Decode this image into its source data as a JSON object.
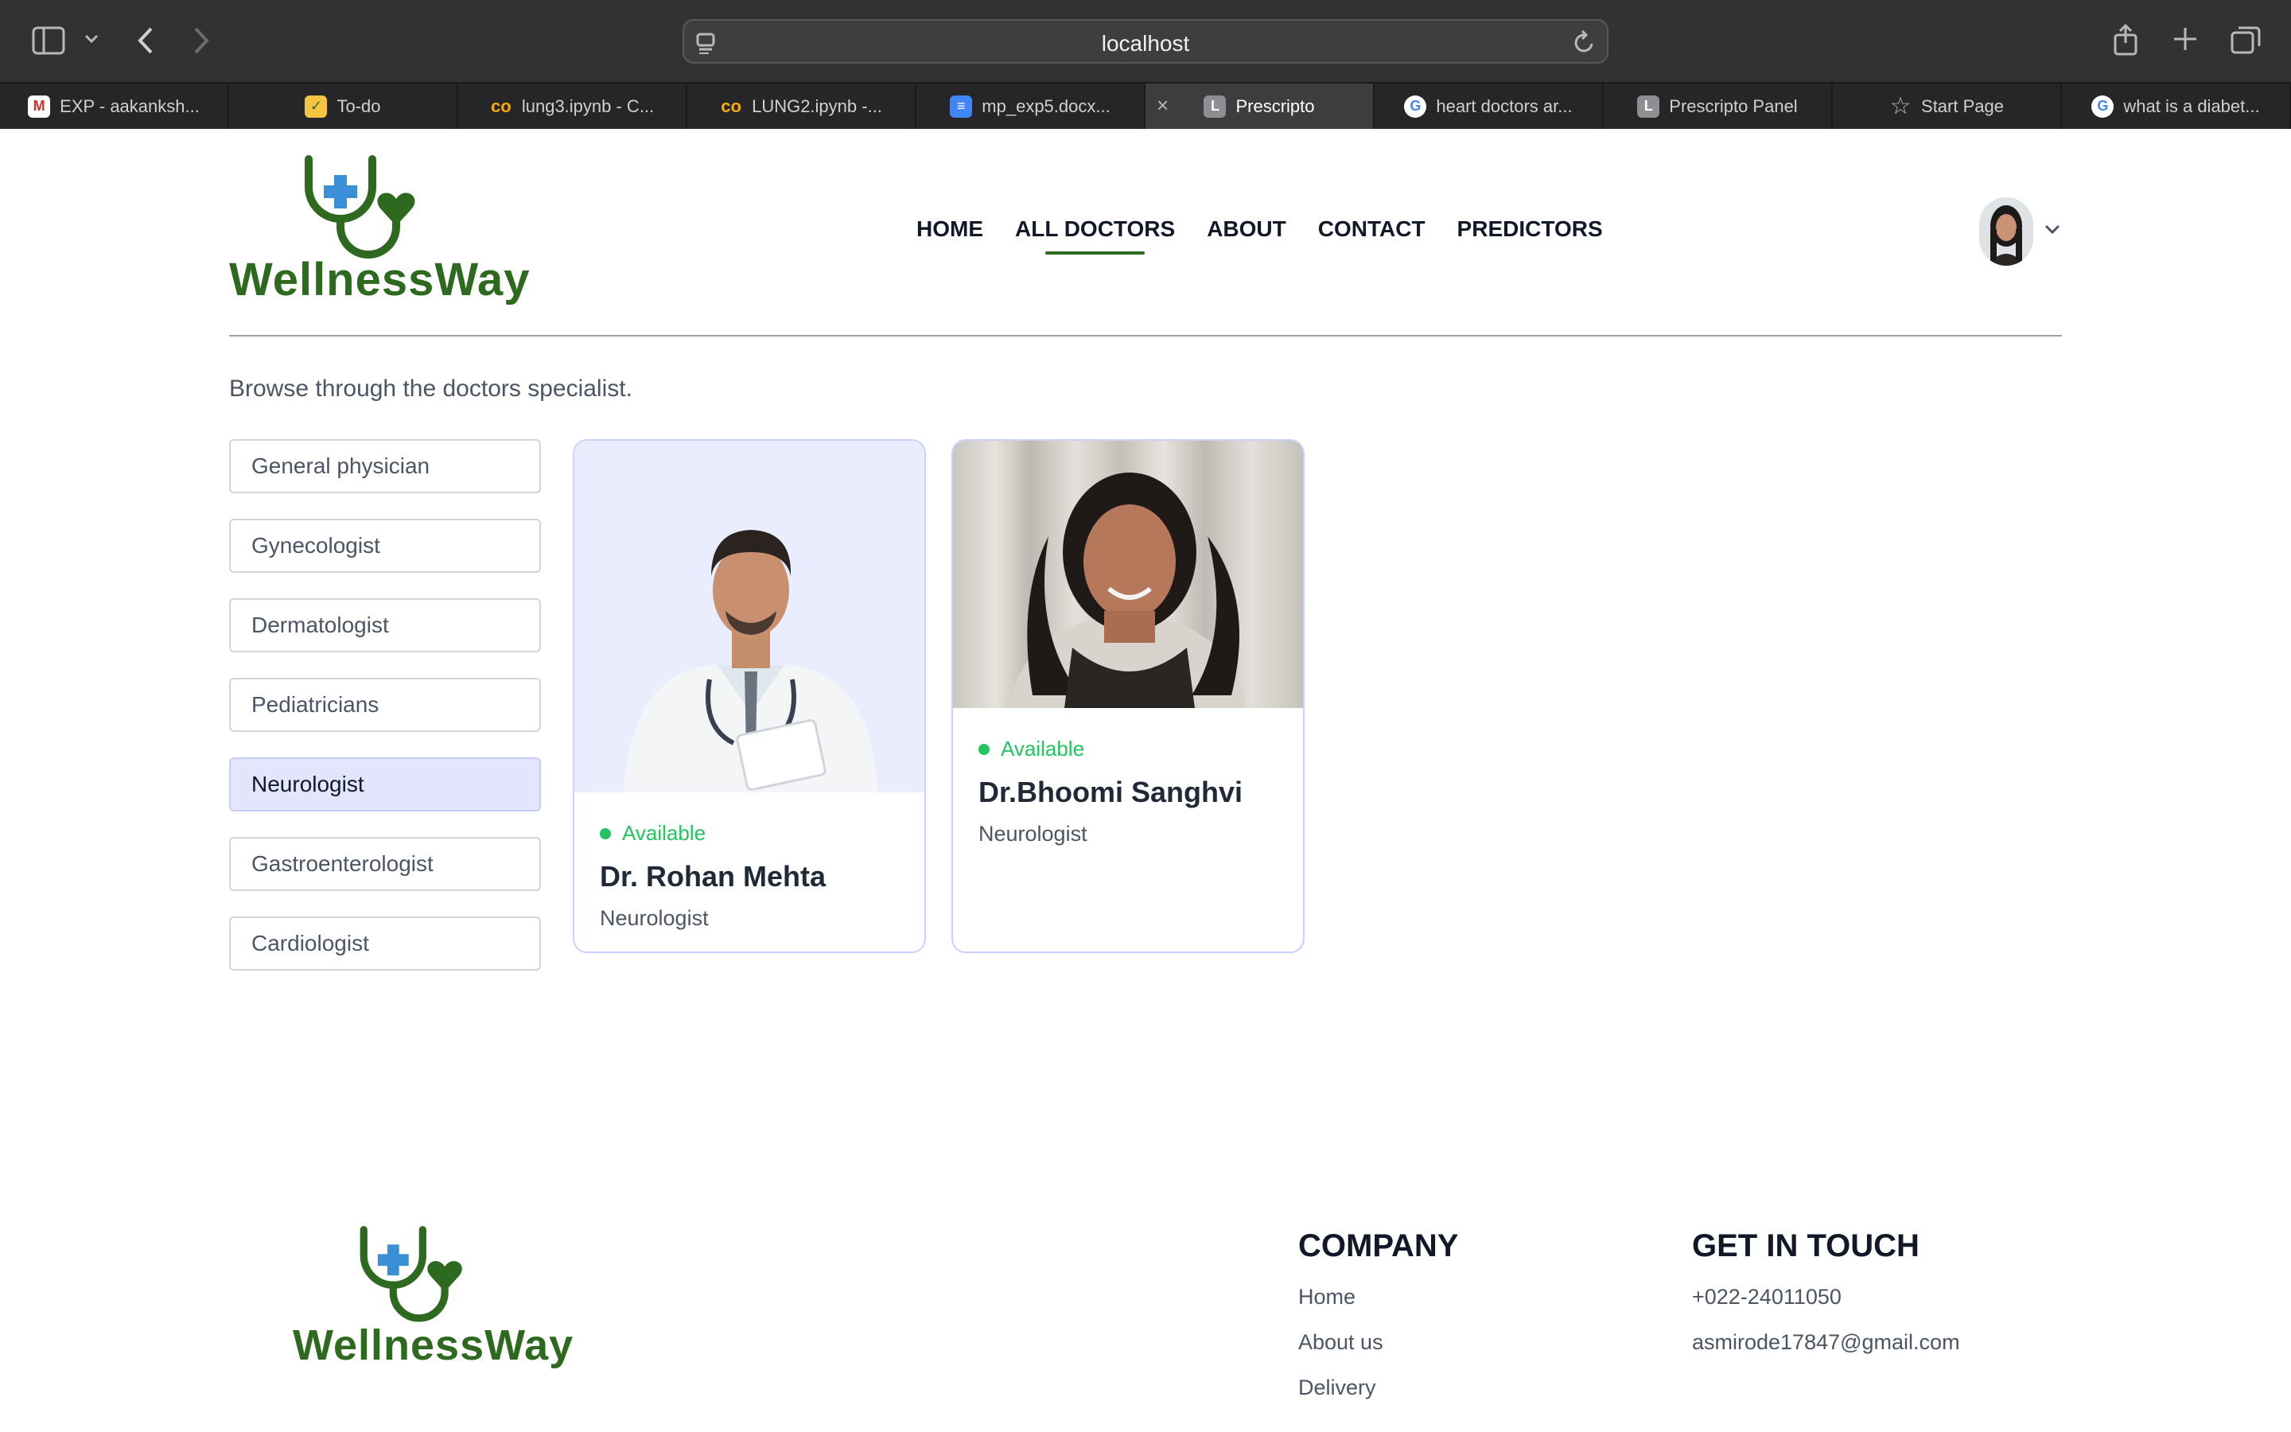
{
  "browser": {
    "url": "localhost",
    "tabs": [
      {
        "title": "EXP - aakanksh...",
        "icon": "gmail-icon"
      },
      {
        "title": "To-do",
        "icon": "todo-icon"
      },
      {
        "title": "lung3.ipynb - C...",
        "icon": "colab-icon"
      },
      {
        "title": "LUNG2.ipynb -...",
        "icon": "colab-icon"
      },
      {
        "title": "mp_exp5.docx...",
        "icon": "docs-icon"
      },
      {
        "title": "Prescripto",
        "icon": "letter-l-icon",
        "active": true
      },
      {
        "title": "heart doctors ar...",
        "icon": "google-icon"
      },
      {
        "title": "Prescripto Panel",
        "icon": "letter-l-icon"
      },
      {
        "title": "Start Page",
        "icon": "star-icon"
      },
      {
        "title": "what is a diabet...",
        "icon": "google-icon"
      }
    ]
  },
  "header": {
    "logo_text": "WellnessWay",
    "nav": [
      "HOME",
      "ALL DOCTORS",
      "ABOUT",
      "CONTACT",
      "PREDICTORS"
    ],
    "active_nav": "ALL DOCTORS"
  },
  "main": {
    "subtitle": "Browse through the doctors specialist.",
    "filters": [
      "General physician",
      "Gynecologist",
      "Dermatologist",
      "Pediatricians",
      "Neurologist",
      "Gastroenterologist",
      "Cardiologist"
    ],
    "active_filter": "Neurologist",
    "doctors": [
      {
        "status": "Available",
        "name": "Dr. Rohan Mehta",
        "speciality": "Neurologist"
      },
      {
        "status": "Available",
        "name": "Dr.Bhoomi Sanghvi",
        "speciality": "Neurologist"
      }
    ]
  },
  "footer": {
    "logo_text": "WellnessWay",
    "company": {
      "heading": "COMPANY",
      "links": [
        "Home",
        "About us",
        "Delivery"
      ]
    },
    "contact": {
      "heading": "GET IN TOUCH",
      "phone": "+022-24011050",
      "email": "asmirode17847@gmail.com"
    }
  },
  "colors": {
    "brand_green": "#2d6a1f",
    "logo_blue": "#3b8fd6",
    "available_green": "#22c55e",
    "active_filter_bg": "#e2e5fb",
    "card_border": "#c7d2fe"
  }
}
